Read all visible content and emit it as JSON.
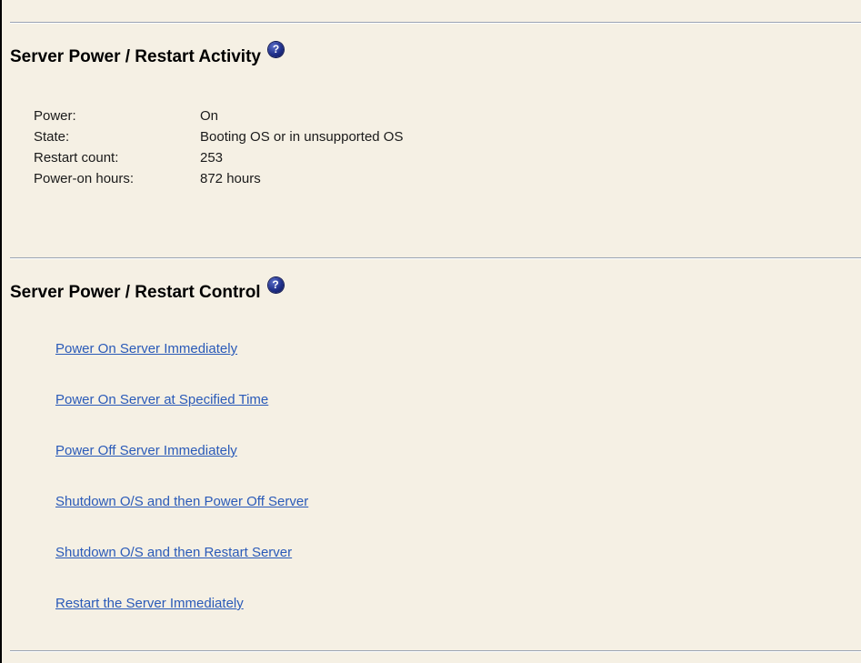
{
  "activity": {
    "title": "Server Power / Restart Activity",
    "help_glyph": "?",
    "rows": [
      {
        "label": "Power:",
        "value": "On"
      },
      {
        "label": "State:",
        "value": "Booting OS or in unsupported OS"
      },
      {
        "label": "Restart count:",
        "value": "253"
      },
      {
        "label": "Power-on hours:",
        "value": "872 hours"
      }
    ]
  },
  "control": {
    "title": "Server Power / Restart Control",
    "help_glyph": "?",
    "links": [
      "Power On Server Immediately",
      "Power On Server at Specified Time",
      "Power Off Server Immediately",
      "Shutdown O/S and then Power Off Server",
      "Shutdown O/S and then Restart Server",
      "Restart the Server Immediately"
    ]
  },
  "icons": {
    "help": "help-icon"
  },
  "colors": {
    "background": "#f5f0e4",
    "link": "#2a5ab8",
    "rule": "#9aa3b2",
    "help_icon": "#1f2f8a"
  }
}
